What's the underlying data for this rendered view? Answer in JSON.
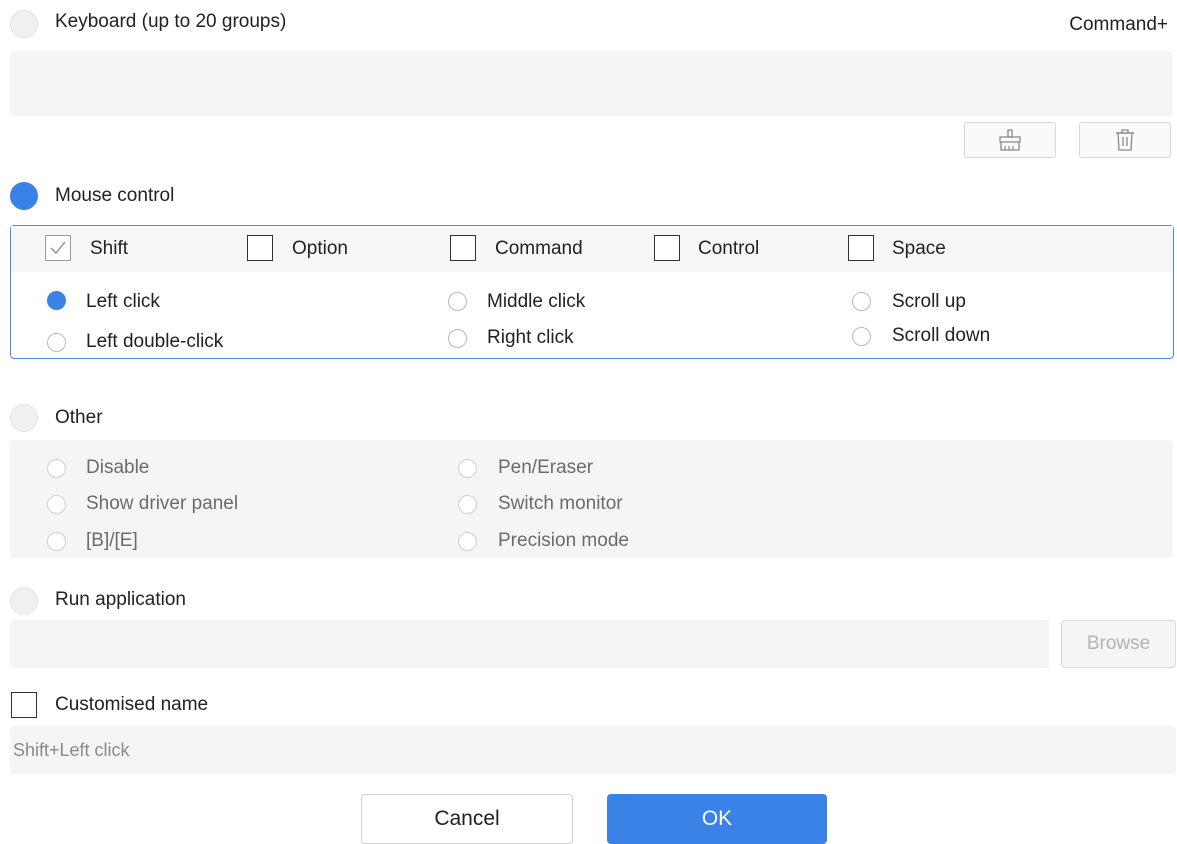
{
  "keyboard": {
    "label": "Keyboard (up to 20 groups)",
    "shortcut_display": "Command+",
    "input_value": "",
    "clear_icon": "broom-icon",
    "delete_icon": "trash-icon",
    "selected": false
  },
  "mouse_control": {
    "label": "Mouse control",
    "selected": true,
    "modifiers": [
      {
        "label": "Shift",
        "checked": true
      },
      {
        "label": "Option",
        "checked": false
      },
      {
        "label": "Command",
        "checked": false
      },
      {
        "label": "Control",
        "checked": false
      },
      {
        "label": "Space",
        "checked": false
      }
    ],
    "actions": [
      {
        "label": "Left click",
        "selected": true
      },
      {
        "label": "Left double-click",
        "selected": false
      },
      {
        "label": "Middle click",
        "selected": false
      },
      {
        "label": "Right click",
        "selected": false
      },
      {
        "label": "Scroll up",
        "selected": false
      },
      {
        "label": "Scroll down",
        "selected": false
      }
    ]
  },
  "other": {
    "label": "Other",
    "selected": false,
    "options": [
      {
        "label": "Disable"
      },
      {
        "label": "Show driver panel"
      },
      {
        "label": "[B]/[E]"
      },
      {
        "label": "Pen/Eraser"
      },
      {
        "label": "Switch monitor"
      },
      {
        "label": "Precision mode"
      }
    ]
  },
  "run_application": {
    "label": "Run application",
    "selected": false,
    "path_value": "",
    "browse_label": "Browse"
  },
  "customised_name": {
    "label": "Customised name",
    "checked": false,
    "value": "Shift+Left click"
  },
  "footer": {
    "cancel_label": "Cancel",
    "ok_label": "OK"
  },
  "colors": {
    "accent": "#3b82e6",
    "field_bg": "#f5f5f5"
  }
}
